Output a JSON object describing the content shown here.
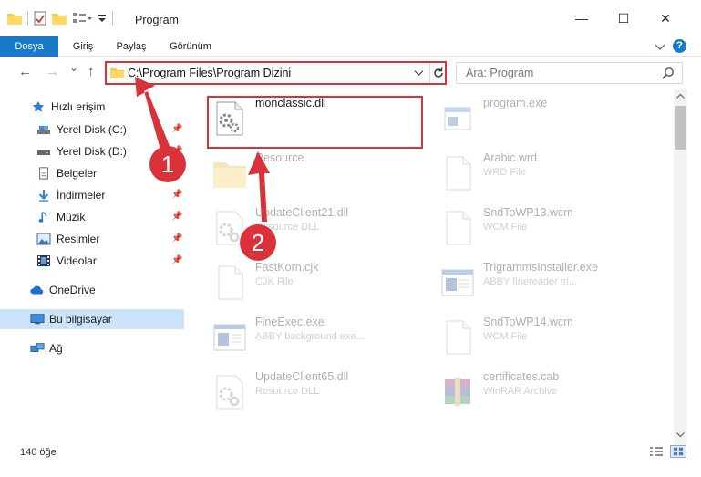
{
  "window": {
    "title": "Program",
    "controls": {
      "minimize": "—",
      "maximize": "☐",
      "close": "✕"
    }
  },
  "ribbon": {
    "tabs": [
      "Dosya",
      "Giriş",
      "Paylaş",
      "Görünüm"
    ],
    "expand_icon": "chevron-down-icon",
    "help_label": "?"
  },
  "navigation": {
    "back": "←",
    "forward": "→",
    "recent": "⌄",
    "up": "↑",
    "address": "C:\\Program Files\\Program Dizini",
    "search_placeholder": "Ara: Program"
  },
  "sidebar": {
    "quick_access": "Hızlı erişim",
    "items": [
      {
        "label": "Yerel Disk (C:)",
        "icon": "drive-icon",
        "pinned": true
      },
      {
        "label": "Yerel Disk (D:)",
        "icon": "drive-icon",
        "pinned": true
      },
      {
        "label": "Belgeler",
        "icon": "documents-icon",
        "pinned": true
      },
      {
        "label": "İndirmeler",
        "icon": "downloads-icon",
        "pinned": true
      },
      {
        "label": "Müzik",
        "icon": "music-icon",
        "pinned": true
      },
      {
        "label": "Resimler",
        "icon": "pictures-icon",
        "pinned": true
      },
      {
        "label": "Videolar",
        "icon": "videos-icon",
        "pinned": true
      }
    ],
    "onedrive": "OneDrive",
    "this_pc": "Bu bilgisayar",
    "network": "Ağ"
  },
  "files": [
    {
      "name": "monclassic.dll",
      "type": "",
      "icon": "dll-icon",
      "highlighted": true
    },
    {
      "name": "program.exe",
      "type": "",
      "icon": "exe-icon",
      "highlighted": false
    },
    {
      "name": "Resource",
      "type": "",
      "icon": "folder-icon",
      "highlighted": false
    },
    {
      "name": "Arabic.wrd",
      "type": "WRD File",
      "icon": "file-icon",
      "highlighted": false
    },
    {
      "name": "UpdateClient21.dll",
      "type": "Resource DLL",
      "icon": "dll-icon",
      "highlighted": false
    },
    {
      "name": "SndToWP13.wcm",
      "type": "WCM File",
      "icon": "file-icon",
      "highlighted": false
    },
    {
      "name": "FastKorn.cjk",
      "type": "CJK File",
      "icon": "file-icon",
      "highlighted": false
    },
    {
      "name": "TrigrammsInstaller.exe",
      "type": "ABBY finereader tri...",
      "icon": "app-window-icon",
      "highlighted": false
    },
    {
      "name": "FineExec.exe",
      "type": "ABBY background exe...",
      "icon": "app-window-icon",
      "highlighted": false
    },
    {
      "name": "SndToWP14.wcm",
      "type": "WCM File",
      "icon": "file-icon",
      "highlighted": false
    },
    {
      "name": "UpdateClient65.dll",
      "type": "Resource DLL",
      "icon": "dll-icon",
      "highlighted": false
    },
    {
      "name": "certificates.cab",
      "type": "WinRAR Archive",
      "icon": "winrar-icon",
      "highlighted": false
    }
  ],
  "status": {
    "count": "140 öğe"
  },
  "annotations": {
    "step1": "1",
    "step2": "2",
    "accent": "#d9323a"
  }
}
